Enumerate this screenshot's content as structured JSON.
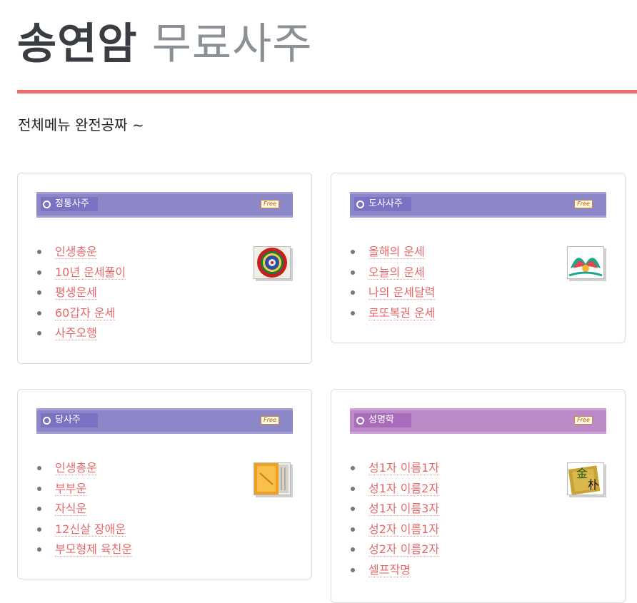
{
  "title": {
    "main": "송연암",
    "sub": "무료사주"
  },
  "subtitle": "전체메뉴 완전공짜 ~",
  "cards": [
    {
      "header": "정통사주",
      "badge": "Free",
      "image_icon": "mandala-icon",
      "items": [
        "인생총운",
        "10년 운세풀이",
        "평생운세",
        "60갑자 운세",
        "사주오행"
      ]
    },
    {
      "header": "도사사주",
      "badge": "Free",
      "image_icon": "lotus-pattern-icon",
      "items": [
        "올해의 운세",
        "오늘의 운세",
        "나의 운세달력",
        "로또복권 운세"
      ]
    },
    {
      "header": "당사주",
      "badge": "Free",
      "image_icon": "scroll-book-icon",
      "items": [
        "인생총운",
        "부부운",
        "자식운",
        "12신살 장애운",
        "부모형제 육친운"
      ]
    },
    {
      "header": "성명학",
      "badge": "Free",
      "image_icon": "name-seal-icon",
      "seal_chars": [
        "金",
        "朴"
      ],
      "items": [
        "성1자 이름1자",
        "성1자 이름2자",
        "성1자 이름3자",
        "성2자 이름1자",
        "성2자 이름2자",
        "셀프작명"
      ]
    }
  ],
  "colors": {
    "accent_rule": "#ee6b6b",
    "link": "#e8686a",
    "header_purple": "#8b87c8",
    "header_pink": "#bd8ac9",
    "title_dark": "#3a3d42",
    "title_gray": "#8a9096"
  }
}
